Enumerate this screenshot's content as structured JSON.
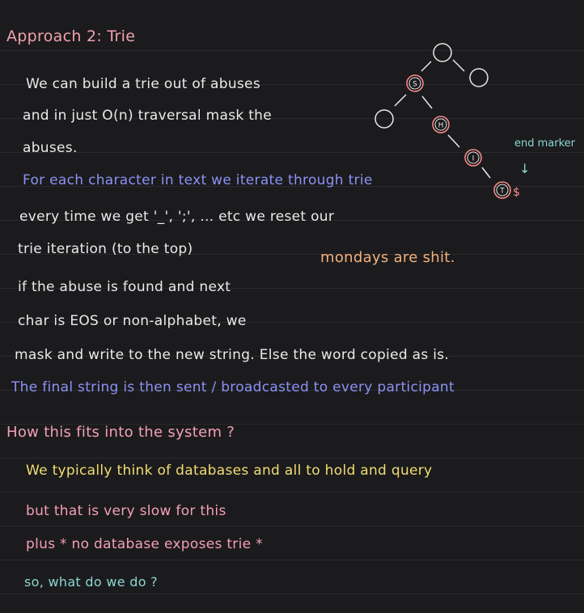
{
  "heading": "Approach 2: Trie",
  "paragraph1": [
    "We can build a trie out of abuses",
    "and in just O(n) traversal mask the",
    "abuses."
  ],
  "paragraph2": "For each character in text we iterate through trie",
  "paragraph3": [
    "every time we get '_', ';', ... etc we reset our",
    "trie iteration (to the top)"
  ],
  "side_note": "mondays are shit.",
  "paragraph4": [
    "if the abuse is found and next",
    "char is EOS or non-alphabet, we",
    "mask and write to the new string. Else the word copied as is."
  ],
  "paragraph5": "The final string is then sent / broadcasted to every participant",
  "section2_heading": "How this fits into the system ?",
  "section2_lines": [
    "We typically think of databases and all to hold and query",
    "but that is very slow for this",
    "plus * no database exposes trie *",
    "so, what do we do ?"
  ],
  "trie_diagram": {
    "node_labels": [
      "S",
      "H",
      "I",
      "T"
    ],
    "end_marker_symbol": "$",
    "end_marker_label": "end marker",
    "arrow": "↓"
  },
  "colors": {
    "background": "#1b1b1d",
    "heading": "#f2a0b0",
    "body": "#eaeaea",
    "blue": "#8b92f4",
    "orange": "#f4b07a",
    "yellow": "#f2dd72",
    "teal": "#8bd8d0",
    "node_red": "#ff8a8a"
  }
}
